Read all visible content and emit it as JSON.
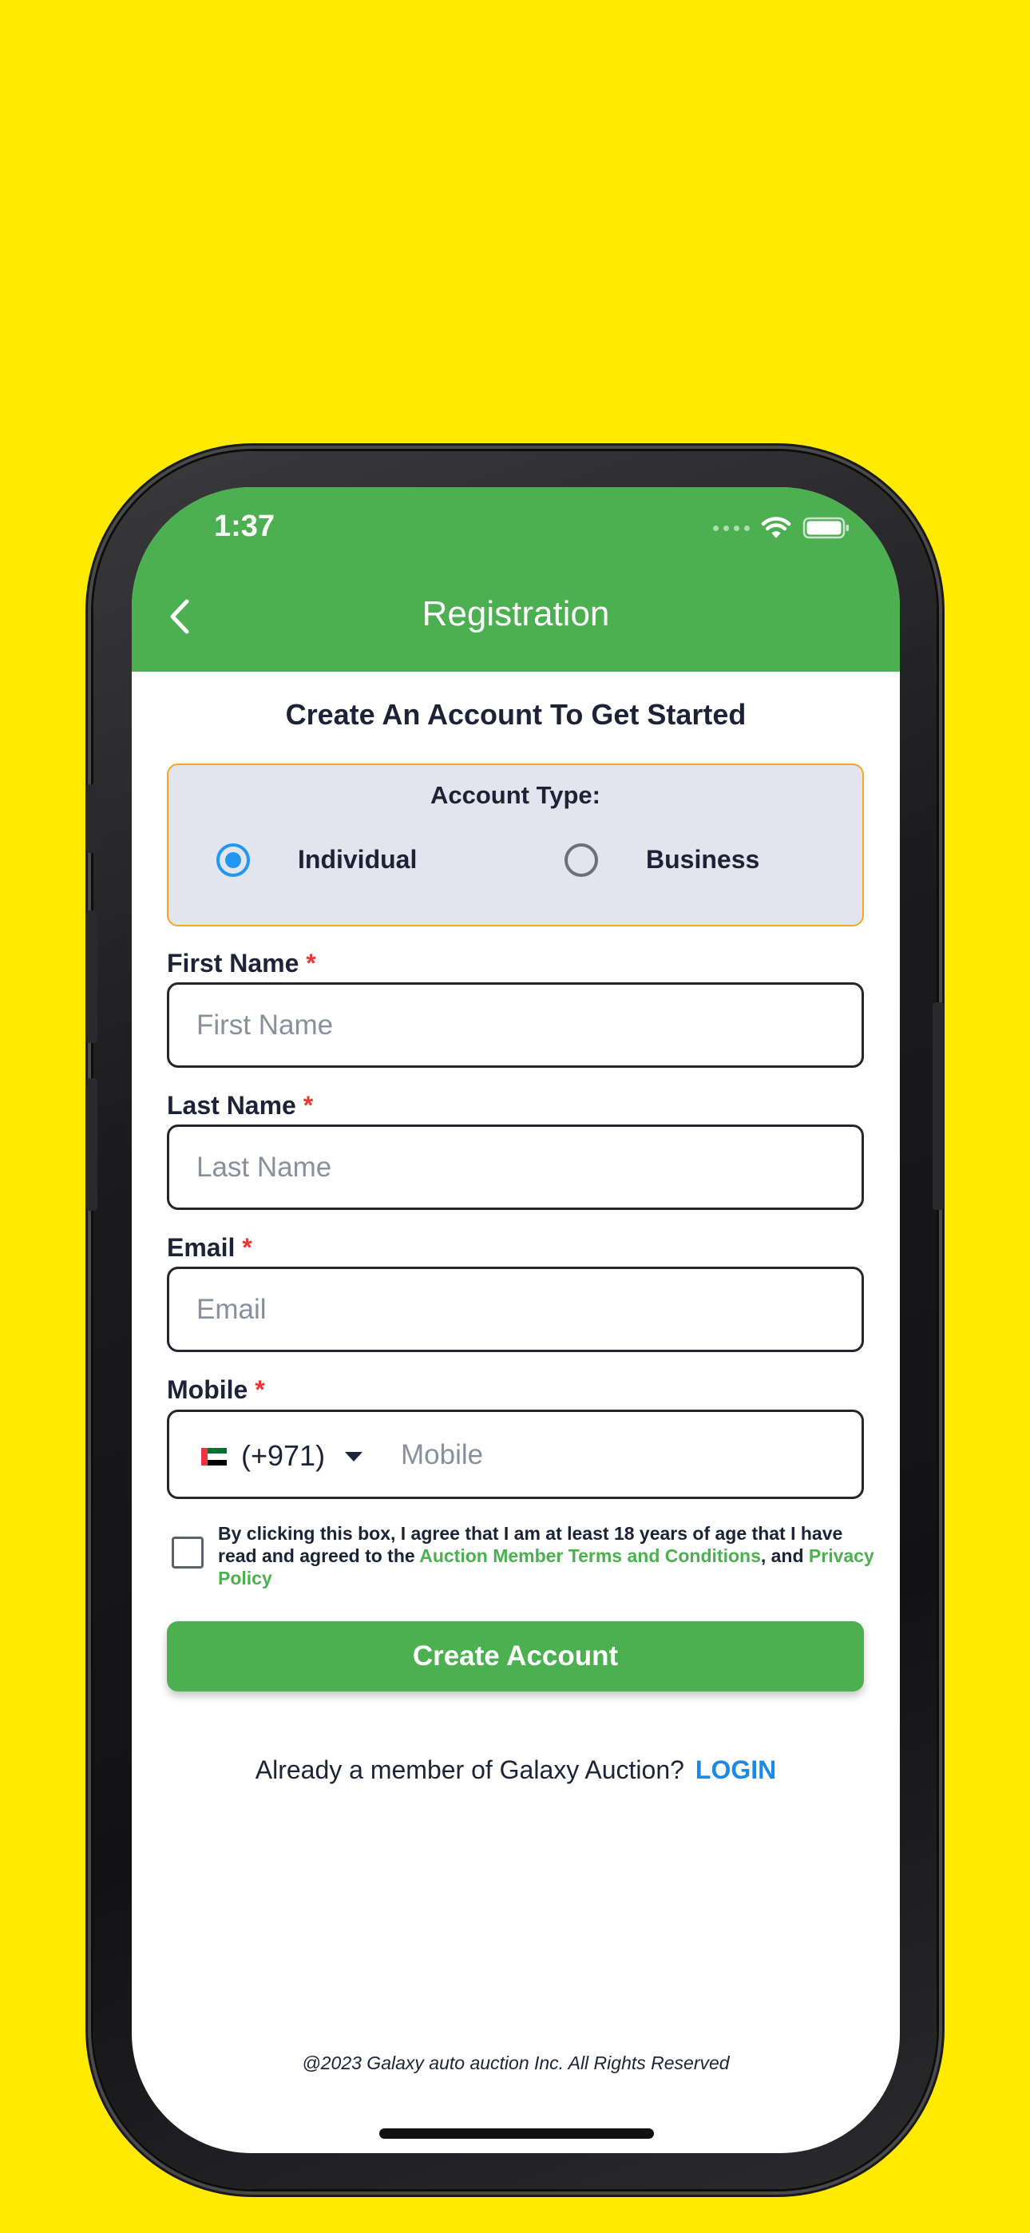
{
  "status_bar": {
    "time": "1:37"
  },
  "header": {
    "title": "Registration"
  },
  "subtitle": "Create An Account To Get Started",
  "account_type": {
    "title": "Account Type:",
    "options": [
      {
        "label": "Individual",
        "selected": true
      },
      {
        "label": "Business",
        "selected": false
      }
    ]
  },
  "fields": {
    "first_name": {
      "label": "First Name",
      "required_mark": "*",
      "placeholder": "First Name",
      "value": ""
    },
    "last_name": {
      "label": "Last Name",
      "required_mark": "*",
      "placeholder": "Last Name",
      "value": ""
    },
    "email": {
      "label": "Email",
      "required_mark": "*",
      "placeholder": "Email",
      "value": ""
    },
    "mobile": {
      "label": "Mobile",
      "required_mark": "*",
      "country_code": "(+971)",
      "placeholder": "Mobile",
      "value": ""
    }
  },
  "terms": {
    "checked": false,
    "text_before": "By clicking this box, I agree that I am at least 18 years of age that I have read and agreed to the ",
    "terms_link": "Auction Member Terms and Conditions",
    "text_middle": ", and ",
    "privacy_link": "Privacy Policy"
  },
  "create_button": "Create Account",
  "login": {
    "prompt": "Already a member of Galaxy Auction?",
    "link": "LOGIN"
  },
  "footer": "@2023  Galaxy auto auction Inc. All Rights Reserved",
  "colors": {
    "background": "#FFEA00",
    "header_green": "#4CAF50",
    "link_blue": "#1E88E5",
    "required_red": "#E53935",
    "account_box_border": "#F5A623",
    "account_box_fill": "#E2E5EE"
  }
}
